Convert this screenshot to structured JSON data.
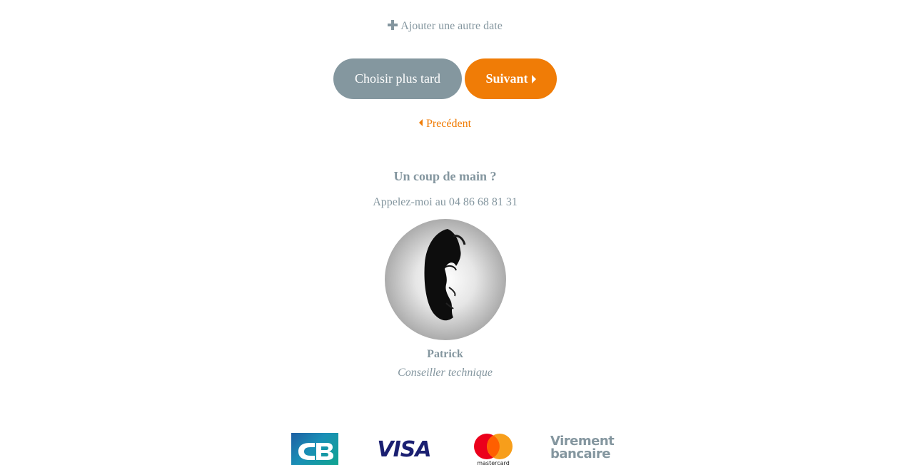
{
  "actions": {
    "add_date_label": "Ajouter une autre date",
    "later_label": "Choisir plus tard",
    "next_label": "Suivant",
    "previous_label": "Precédent"
  },
  "help": {
    "title": "Un coup de main ?",
    "phone_text": "Appelez-moi au 04 86 68 81 31"
  },
  "advisor": {
    "name": "Patrick",
    "role": "Conseiller technique"
  },
  "payments": {
    "cb_label": "CB",
    "visa_label": "VISA",
    "mastercard_label": "mastercard",
    "transfer_line1": "Virement",
    "transfer_line2": "bancaire"
  },
  "colors": {
    "accent": "#f07c06",
    "muted": "#84969f"
  },
  "icons": [
    "plus-icon",
    "caret-right-icon",
    "caret-left-icon"
  ]
}
